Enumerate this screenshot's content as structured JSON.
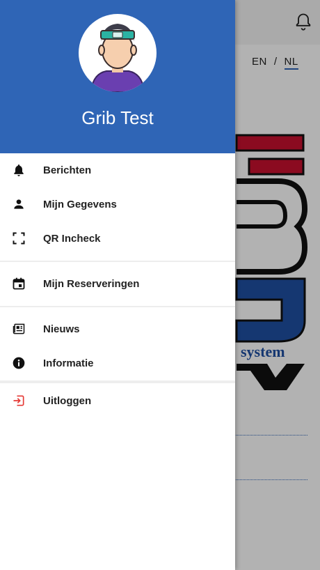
{
  "background": {
    "language": {
      "en": "EN",
      "separator": "/",
      "nl": "NL"
    },
    "logo_text": "system"
  },
  "drawer": {
    "user_name": "Grib Test",
    "menu": [
      {
        "label": "Berichten",
        "icon": "bell-icon"
      },
      {
        "label": "Mijn Gegevens",
        "icon": "person-icon"
      },
      {
        "label": "QR Incheck",
        "icon": "qr-scan-icon"
      },
      {
        "label": "Mijn Reserveringen",
        "icon": "calendar-icon"
      },
      {
        "label": "Nieuws",
        "icon": "newspaper-icon"
      },
      {
        "label": "Informatie",
        "icon": "info-icon"
      },
      {
        "label": "Uitloggen",
        "icon": "logout-icon"
      }
    ]
  },
  "colors": {
    "header_blue": "#2f65b6",
    "logout_red": "#e53935",
    "logo_red": "#c8102e",
    "logo_blue": "#1f4fa3"
  }
}
